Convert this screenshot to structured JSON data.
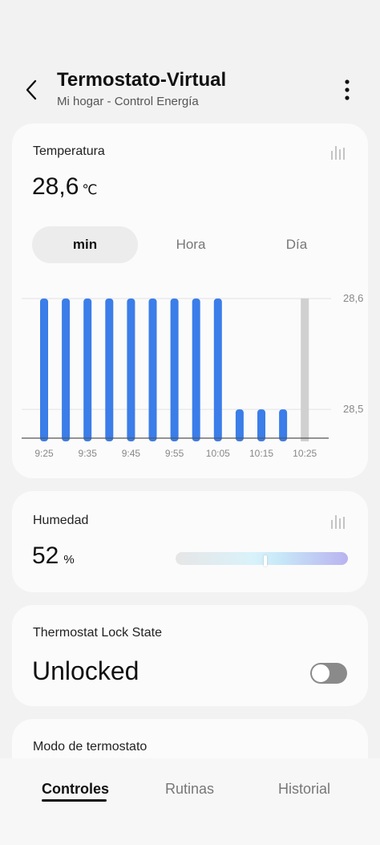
{
  "header": {
    "title": "Termostato-Virtual",
    "subtitle": "Mi hogar - Control Energía",
    "back_icon": "chevron-left-icon",
    "menu_icon": "more-vertical-icon"
  },
  "temperature_card": {
    "title": "Temperatura",
    "value": "28,6",
    "unit": "℃",
    "history_icon": "bar-chart-icon",
    "segments": [
      {
        "label": "min",
        "active": true
      },
      {
        "label": "Hora",
        "active": false
      },
      {
        "label": "Día",
        "active": false
      }
    ]
  },
  "chart_data": {
    "type": "bar",
    "categories": [
      "9:25",
      "9:30",
      "9:35",
      "9:40",
      "9:45",
      "9:50",
      "9:55",
      "10:00",
      "10:05",
      "10:10",
      "10:15",
      "10:20",
      "10:25"
    ],
    "x_tick_labels": [
      "9:25",
      "9:35",
      "9:45",
      "9:55",
      "10:05",
      "10:15",
      "10:25"
    ],
    "values": [
      28.6,
      28.6,
      28.6,
      28.6,
      28.6,
      28.6,
      28.6,
      28.6,
      28.6,
      28.5,
      28.5,
      28.5,
      28.6
    ],
    "y_tick_labels": [
      "28,6",
      "28,5"
    ],
    "ylim": [
      28.474,
      28.6
    ],
    "bar_color": "#3b7de9",
    "current_bar_color": "#d0d0d0",
    "grid": true,
    "title": "",
    "xlabel": "",
    "ylabel": ""
  },
  "humidity_card": {
    "title": "Humedad",
    "value": "52",
    "unit": "%",
    "history_icon": "bar-chart-icon",
    "slider_level": 0.52
  },
  "lock_card": {
    "title": "Thermostat Lock State",
    "value": "Unlocked",
    "toggle_on": false
  },
  "mode_card": {
    "title": "Modo de termostato"
  },
  "bottom_nav": {
    "tabs": [
      {
        "label": "Controles",
        "active": true
      },
      {
        "label": "Rutinas",
        "active": false
      },
      {
        "label": "Historial",
        "active": false
      }
    ]
  },
  "colors": {
    "accent": "#3b7de9",
    "background": "#f2f2f2",
    "card": "#fbfbfb"
  }
}
